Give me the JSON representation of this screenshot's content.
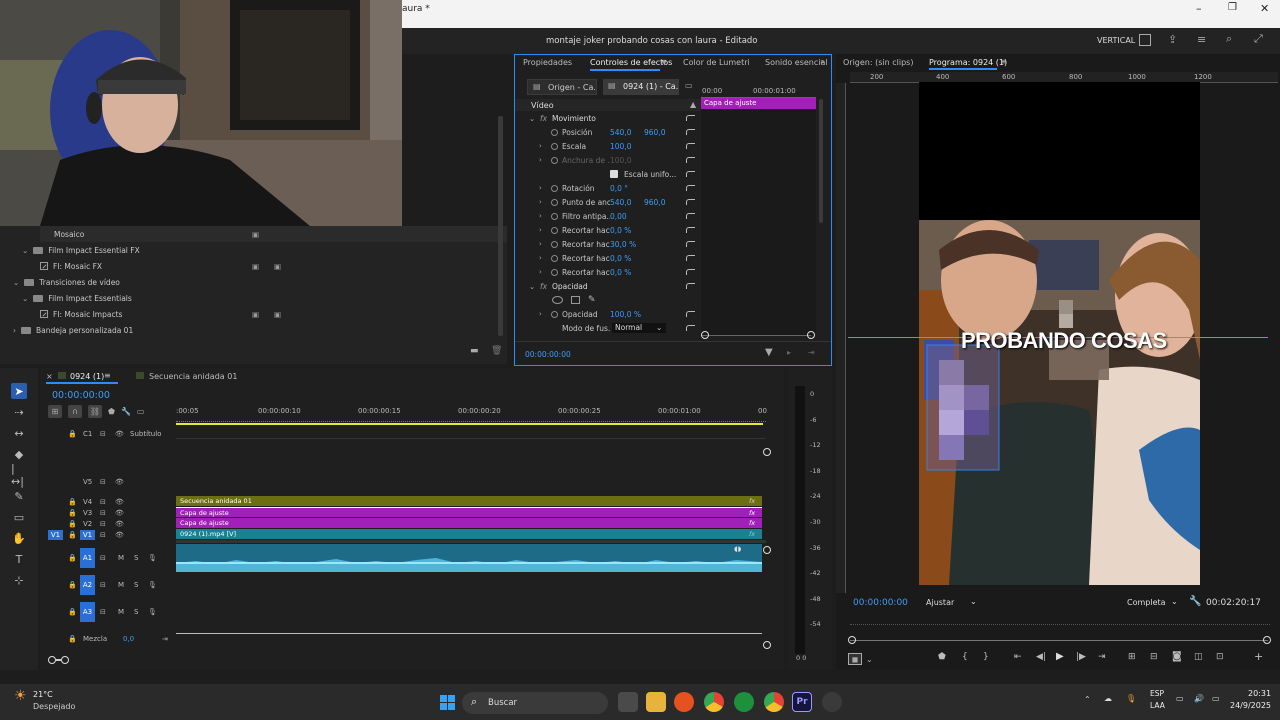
{
  "window": {
    "title": "aura *"
  },
  "app": {
    "project_title": "montaje joker probando cosas con laura - Editado",
    "workspace": "VERTICAL"
  },
  "bins": {
    "items": [
      {
        "label": "Mosaico"
      },
      {
        "label": "Film Impact Essential FX"
      },
      {
        "label": "FI: Mosaic FX"
      },
      {
        "label": "Transiciones de vídeo"
      },
      {
        "label": "Film Impact Essentials"
      },
      {
        "label": "FI: Mosaic Impacts"
      },
      {
        "label": "Bandeja personalizada 01"
      }
    ]
  },
  "effects_panel": {
    "tabs": [
      "Propiedades",
      "Controles de efectos",
      "Color de Lumetri",
      "Sonido esencial"
    ],
    "source_tab": "Origen - Ca...",
    "seq_tab": "0924 (1) - Ca...",
    "mini_time_start": "00:00",
    "mini_time_end": "00:00:01:00",
    "clip_label": "Capa de ajuste",
    "section_video": "Vídeo",
    "section_movimiento": "Movimiento",
    "rows": [
      {
        "name": "Posición",
        "v1": "540,0",
        "v2": "960,0"
      },
      {
        "name": "Escala",
        "v1": "100,0",
        "v2": ""
      },
      {
        "name": "Anchura de ...",
        "v1": "100,0",
        "v2": ""
      },
      {
        "name": "Rotación",
        "v1": "0,0 °",
        "v2": ""
      },
      {
        "name": "Punto de anc...",
        "v1": "540,0",
        "v2": "960,0"
      },
      {
        "name": "Filtro antipa...",
        "v1": "0,00",
        "v2": ""
      },
      {
        "name": "Recortar hac...",
        "v1": "0,0 %",
        "v2": ""
      },
      {
        "name": "Recortar hac...",
        "v1": "30,0 %",
        "v2": ""
      },
      {
        "name": "Recortar hac...",
        "v1": "0,0 %",
        "v2": ""
      },
      {
        "name": "Recortar hac...",
        "v1": "0,0 %",
        "v2": ""
      }
    ],
    "escala_uniforme": "Escala unifo...",
    "section_opacidad": "Opacidad",
    "opacidad_label": "Opacidad",
    "opacidad_value": "100,0 %",
    "blend_label": "Modo de fus...",
    "blend_value": "Normal",
    "footer_time": "00:00:00:00"
  },
  "program_monitor": {
    "source_tab": "Origen: (sin clips)",
    "program_tab": "Programa: 0924 (1)",
    "ruler": [
      "200",
      "400",
      "600",
      "800",
      "1000",
      "1200"
    ],
    "overlay_text": "PROBANDO COSAS",
    "timecode": "00:00:00:00",
    "fit": "Ajustar",
    "quality": "Completa",
    "duration": "00:02:20:17"
  },
  "timeline": {
    "tabs": [
      "0924 (1)",
      "Secuencia anidada 01"
    ],
    "timecode": "00:00:00:00",
    "ruler": [
      ":00:05",
      "00:00:00:10",
      "00:00:00:15",
      "00:00:00:20",
      "00:00:00:25",
      "00:00:01:00",
      "00"
    ],
    "subtitle_track": {
      "id": "C1",
      "label": "Subtítulo"
    },
    "video_tracks": [
      "V5",
      "V4",
      "V3",
      "V2",
      "V1"
    ],
    "audio_tracks": [
      "A1",
      "A2",
      "A3"
    ],
    "source_patch_v": "V1",
    "clips": {
      "v4": "Secuencia anidada 01",
      "v3": "Capa de ajuste",
      "v2": "Capa de ajuste",
      "v1": "0924 (1).mp4 [V]"
    },
    "mix_label": "Mezcla",
    "mix_value": "0,0",
    "track_btn_m": "M",
    "track_btn_s": "S"
  },
  "meter": {
    "scale": [
      "0",
      "-6",
      "-12",
      "-18",
      "-24",
      "-30",
      "-36",
      "-42",
      "-48",
      "-54"
    ],
    "footer": "0 0"
  },
  "taskbar": {
    "weather_temp": "21°C",
    "weather_desc": "Despejado",
    "search": "Buscar",
    "lang1": "ESP",
    "lang2": "LAA",
    "time": "20:31",
    "date": "24/9/2025"
  },
  "colors": {
    "accent": "#2a8cff",
    "adjust_layer": "#a020b8",
    "nested": "#6b6f12",
    "video_clip": "#1c7f94",
    "audio_clip": "#1d6b86"
  }
}
